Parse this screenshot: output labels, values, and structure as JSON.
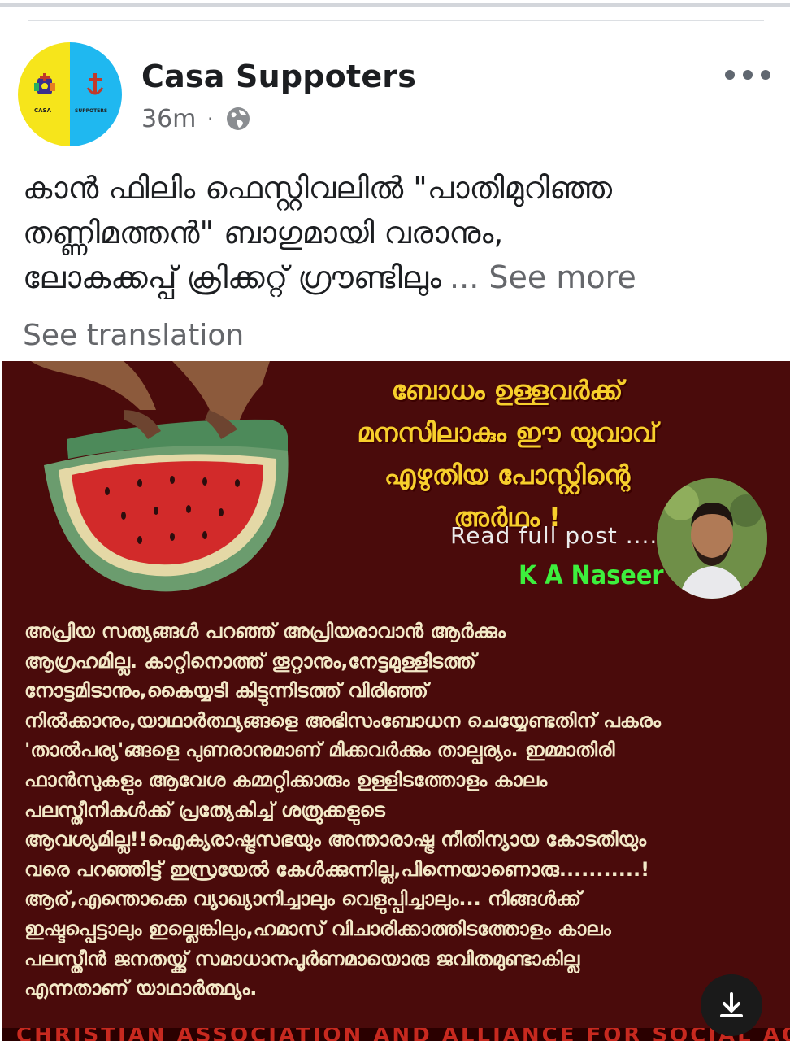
{
  "post": {
    "page_name": "Casa Suppoters",
    "time_ago": "36m",
    "separator": "·",
    "visibility_icon": "globe-icon",
    "more_icon": "more-horizontal-icon",
    "avatar": {
      "left_label": "CASA",
      "right_label": "SUPPOTERS",
      "colors": {
        "left": "#f6e51b",
        "right": "#1fb8f0"
      }
    },
    "caption_lines": [
      "കാൻ ഫിലിം ഫെസ്റ്റിവലിൽ \"പാതിമുറിഞ്ഞ",
      "തണ്ണിമത്തൻ\" ബാഗുമായി വരാനും,",
      "ലോകക്കപ്പ് ക്രിക്കറ്റ് ഗ്രൗണ്ടിലും"
    ],
    "see_more_label": "... See more",
    "see_translation_label": "See translation"
  },
  "image": {
    "headline_lines": [
      "ബോധം ഉള്ളവർക്ക്",
      "മനസിലാകും ഈ യുവാവ്",
      "എഴുതിയ പോസ്റ്റിന്റെ",
      "അർഥം !"
    ],
    "read_full_label": "Read full post ....",
    "author_name": "K A Naseer",
    "body_lines": [
      "അപ്രിയ സത്യങ്ങൾ പറഞ്ഞ് അപ്രിയരാവാൻ ആർക്കും",
      "ആഗ്രഹമില്ല. കാറ്റിനൊത്ത് തൂറ്റാനും,നേട്ടമുള്ളിടത്ത്",
      "നോട്ടമിടാനും,കൈയ്യടി കിട്ടുന്നിടത്ത് വിരിഞ്ഞ്",
      "നിൽക്കാനും,യാഥാർത്ഥ്യങ്ങളെ അഭിസംബോധന ചെയ്യേണ്ടതിന് പകരം",
      "'താൽപര്യ'ങ്ങളെ പുണരാനുമാണ് മിക്കവർക്കും താല്പര്യം. ഇമ്മാതിരി",
      "ഫാൻസുകളും ആവേശ കമ്മറ്റിക്കാരും ഉള്ളിടത്തോളം കാലം",
      "പലസ്തീനികൾക്ക് പ്രത്യേകിച്ച് ശത്രുക്കളുടെ",
      "ആവശ്യമില്ല!!ഐക്യരാഷ്ട്രസഭയും അന്താരാഷ്ട്ര നീതിന്യായ കോടതിയും",
      "വരെ പറഞ്ഞിട്ട് ഇസ്രയേൽ കേൾക്കുന്നില്ല,പിന്നെയാണൊരു...........!",
      "ആര്,എന്തൊക്കെ വ്യാഖ്യാനിച്ചാലും വെളുപ്പിച്ചാലും... നിങ്ങൾക്ക്",
      "ഇഷ്ടപ്പെട്ടാലും ഇല്ലെങ്കിലും,ഹമാസ് വിചാരിക്കാത്തിടത്തോളം കാലം",
      "പലസ്തീൻ ജനതയ്ക്ക് സമാധാനപൂർണമായൊരു ജവിതമുണ്ടാകില്ല",
      "എന്നതാണ് യാഥാർത്ഥ്യം."
    ],
    "footer_text": "CHRISTIAN ASSOCIATION AND ALLIANCE FOR SOCIAL ACTION",
    "colors": {
      "background": "#4a0b0b",
      "headline": "#f7cf2c",
      "author": "#3df03d",
      "footer": "#c7291f"
    }
  },
  "download_icon": "download-icon"
}
